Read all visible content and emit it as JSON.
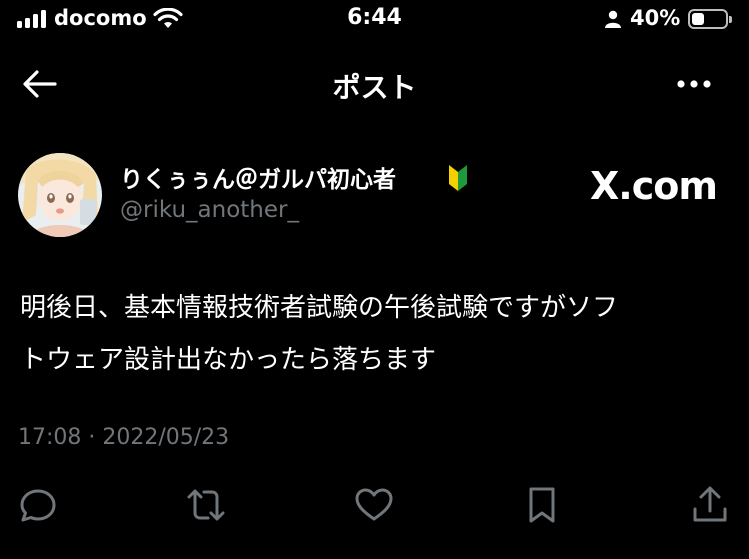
{
  "status_bar": {
    "carrier": "docomo",
    "time": "6:44",
    "battery_percent": "40%"
  },
  "nav": {
    "title": "ポスト",
    "back_icon": "arrow-left-icon",
    "more_icon": "more-horizontal-icon"
  },
  "tweet": {
    "display_name": "りくぅぅん＠ガルパ初心者",
    "badge_icon": "beginner-mark-icon",
    "handle": "@riku_another_",
    "text_line1": "明後日、基本情報技術者試験の午後試験ですがソフ",
    "text_line2": "トウェア設計出なかったら落ちます",
    "timestamp": "17:08 · 2022/05/23",
    "watermark": "X.com"
  },
  "actions": [
    "reply-icon",
    "retweet-icon",
    "like-icon",
    "bookmark-icon",
    "share-icon"
  ],
  "colors": {
    "background": "#000000",
    "text": "#ffffff",
    "secondary": "#71767b",
    "icon": "#71767b"
  }
}
